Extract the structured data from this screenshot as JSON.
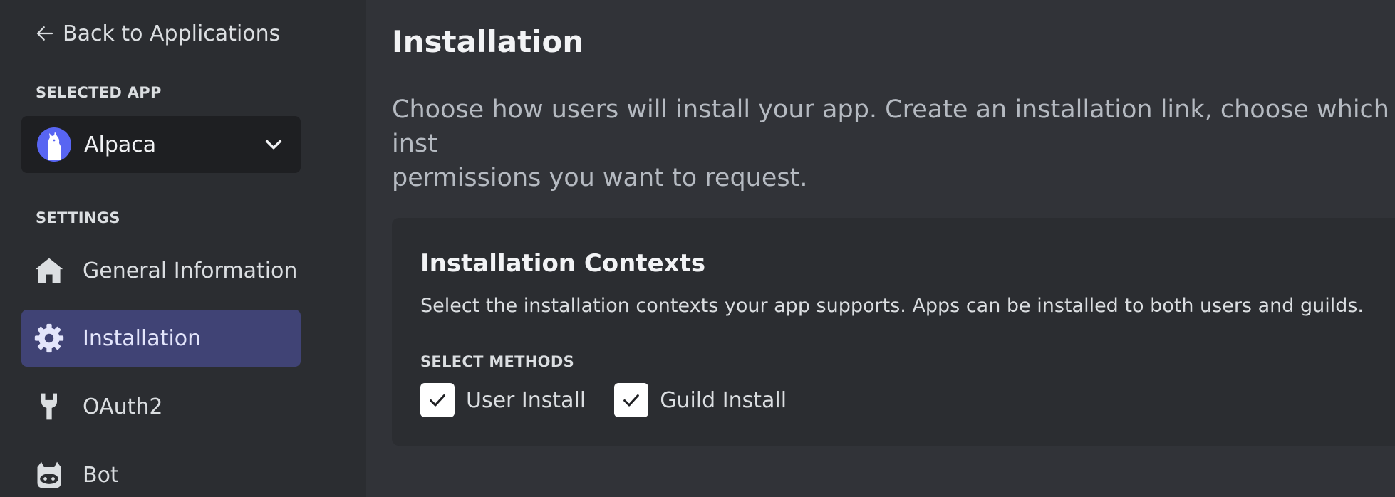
{
  "sidebar": {
    "back_label": "Back to Applications",
    "selected_app_heading": "SELECTED APP",
    "selected_app": {
      "name": "Alpaca",
      "avatar_color": "#5865f2"
    },
    "settings_heading": "SETTINGS",
    "nav_items": [
      {
        "label": "General Information",
        "icon": "home-icon",
        "active": false
      },
      {
        "label": "Installation",
        "icon": "gear-icon",
        "active": true
      },
      {
        "label": "OAuth2",
        "icon": "wrench-icon",
        "active": false
      },
      {
        "label": "Bot",
        "icon": "robot-icon",
        "active": false
      }
    ]
  },
  "main": {
    "title": "Installation",
    "description": "Choose how users will install your app. Create an installation link, choose which inst\npermissions you want to request.",
    "installation_contexts": {
      "title": "Installation Contexts",
      "description": "Select the installation contexts your app supports. Apps can be installed to both users and guilds.",
      "methods_heading": "SELECT METHODS",
      "methods": [
        {
          "label": "User Install",
          "checked": true
        },
        {
          "label": "Guild Install",
          "checked": true
        }
      ]
    }
  },
  "colors": {
    "background": "#313338",
    "sidebar": "#2b2d31",
    "active_nav": "#404375",
    "accent": "#5865f2"
  }
}
